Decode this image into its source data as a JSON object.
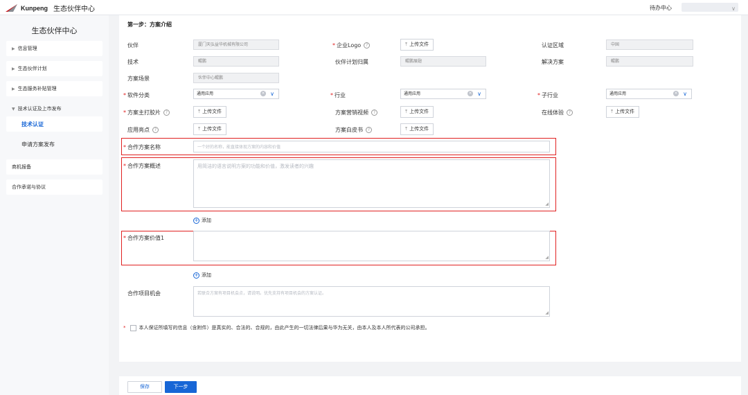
{
  "header": {
    "brand": "Kunpeng",
    "subtitle": "生态伙伴中心",
    "todo": "待办中心",
    "user_chevron": "∨",
    "logo_icon": "kunpeng-logo-icon"
  },
  "sidebar": {
    "title": "生态伙伴中心",
    "items": [
      {
        "label": "信息管理",
        "arrow": "▶"
      },
      {
        "label": "生态伙伴计划",
        "arrow": "▶"
      },
      {
        "label": "生态服务补贴管理",
        "arrow": "▶"
      },
      {
        "label": "技术认证及上市发布",
        "arrow": "▼"
      },
      {
        "label": "技术认证"
      },
      {
        "label": "申请方案发布"
      },
      {
        "label": "商机报备"
      },
      {
        "label": "合作承诺与协议"
      }
    ]
  },
  "form": {
    "step": "第一步：方案介绍",
    "required_mark": "*",
    "help_glyph": "?",
    "upload_icon": "⤒",
    "upload_label": "上传文件",
    "clear_glyph": "×",
    "chevron": "∨",
    "partner": {
      "label": "伙伴",
      "value": "厦门天弘益华机械有限公司"
    },
    "logo": {
      "label": "企业Logo"
    },
    "region": {
      "label": "认证区域",
      "value": "中国"
    },
    "tech": {
      "label": "技术",
      "value": "鲲鹏"
    },
    "plan": {
      "label": "伙伴计划归属",
      "value": "鲲鹏展翅"
    },
    "solution": {
      "label": "解决方案",
      "value": "鲲鹏"
    },
    "scene": {
      "label": "方案场景",
      "value": "伙伴中心鲲鹏"
    },
    "software": {
      "label": "软件分类",
      "value": "通用应用"
    },
    "industry": {
      "label": "行业",
      "value": "通用应用"
    },
    "subindustry": {
      "label": "子行业",
      "value": "通用应用"
    },
    "main_image": {
      "label": "方案主打胶片"
    },
    "video": {
      "label": "方案营销视频"
    },
    "online": {
      "label": "在线体验"
    },
    "highlight": {
      "label": "应用亮点"
    },
    "whitepaper": {
      "label": "方案白皮书"
    },
    "name": {
      "label": "合作方案名称",
      "placeholder": "一个好的名称，能直接体现方案的内容和价值"
    },
    "overview": {
      "label": "合作方案概述",
      "placeholder": "用简洁的语言说明方案的功能和价值，激发读者的兴趣"
    },
    "add_label": "添加",
    "add_icon": "+",
    "value": {
      "label": "合作方案价值1",
      "placeholder": ""
    },
    "opportunity": {
      "label": "合作项目机会",
      "placeholder": "若联合方案有项目机会点，请说明。优先支持有项目机会的方案认证。"
    },
    "agreement": "本人保证所填写的信息（含附件）是真实的、合法的、合规的，由此产生的一切法律后果与华为无关，由本人及本人所代表的公司承担。"
  },
  "buttons": {
    "save": "保存",
    "next": "下一步"
  },
  "colors": {
    "accent": "#1766d6",
    "highlight_border": "#e02020"
  }
}
